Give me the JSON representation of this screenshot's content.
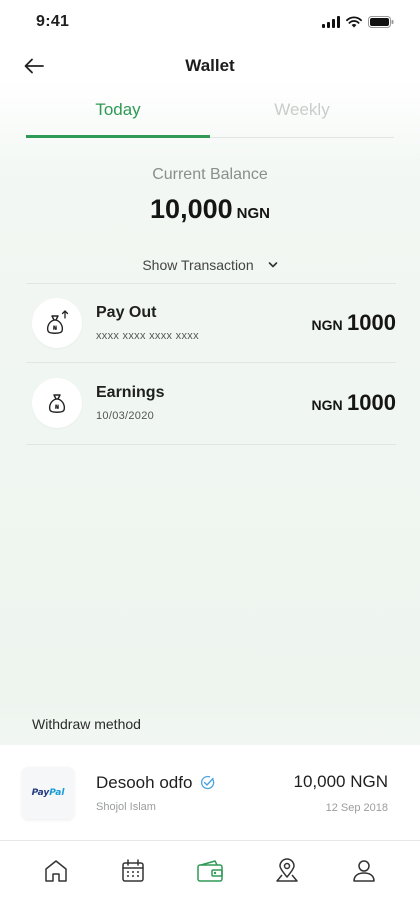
{
  "status_bar": {
    "time": "9:41"
  },
  "header": {
    "title": "Wallet"
  },
  "tabs": [
    {
      "label": "Today",
      "active": true
    },
    {
      "label": "Weekly",
      "active": false
    }
  ],
  "balance": {
    "label": "Current Balance",
    "amount": "10,000",
    "currency": "NGN"
  },
  "show_transaction": {
    "label": "Show Transaction"
  },
  "transactions": [
    {
      "title": "Pay Out",
      "subtitle": "xxxx xxxx xxxx xxxx",
      "currency": "NGN",
      "amount": "1000",
      "icon": "money-bag-out-icon"
    },
    {
      "title": "Earnings",
      "subtitle": "10/03/2020",
      "currency": "NGN",
      "amount": "1000",
      "icon": "money-bag-icon"
    }
  ],
  "withdraw": {
    "section_label": "Withdraw method",
    "logo_text_1": "Pay",
    "logo_text_2": "Pal",
    "name": "Desooh odfo",
    "user": "Shojol Islam",
    "amount": "10,000 NGN",
    "date": "12 Sep 2018"
  },
  "nav": [
    {
      "name": "home",
      "icon": "home-icon",
      "active": false
    },
    {
      "name": "calendar",
      "icon": "calendar-icon",
      "active": false
    },
    {
      "name": "wallet",
      "icon": "wallet-icon",
      "active": true
    },
    {
      "name": "map",
      "icon": "map-pin-icon",
      "active": false
    },
    {
      "name": "profile",
      "icon": "user-icon",
      "active": false
    }
  ],
  "colors": {
    "accent": "#2f9a55",
    "verified": "#4aa3df",
    "inactive_tab": "#c9cdca"
  }
}
